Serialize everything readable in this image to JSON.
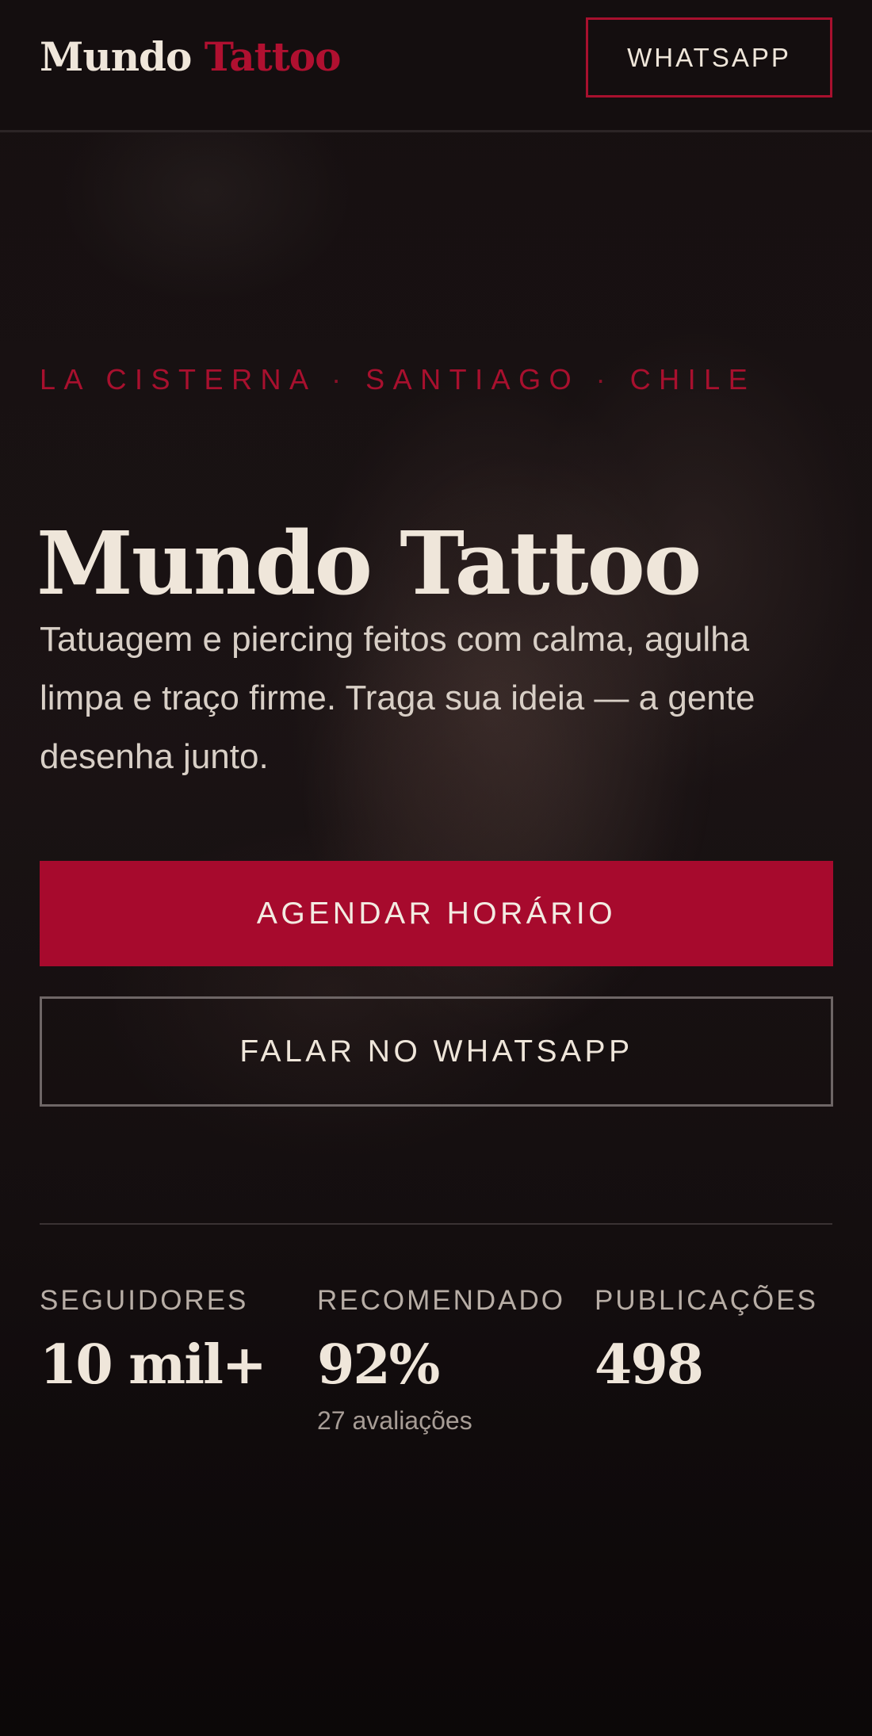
{
  "header": {
    "brand_part1": "Mundo",
    "brand_part2": "Tattoo",
    "whatsapp_label": "WHATSAPP"
  },
  "hero": {
    "location": {
      "part1": "LA CISTERNA",
      "separator": "·",
      "part2": "SANTIAGO",
      "part3": "CHILE"
    },
    "title": "Mundo Tattoo",
    "description": "Tatuagem e piercing feitos com calma, agulha limpa e traço firme. Traga sua ideia — a gente desenha junto.",
    "primary_cta": "AGENDAR HORÁRIO",
    "secondary_cta": "FALAR NO WHATSAPP"
  },
  "stats": [
    {
      "label": "SEGUIDORES",
      "value": "10 mil+",
      "sub": ""
    },
    {
      "label": "RECOMENDADO",
      "value": "92%",
      "sub": "27 avaliações"
    },
    {
      "label": "PUBLICAÇÕES",
      "value": "498",
      "sub": ""
    }
  ],
  "colors": {
    "accent": "#a70a2d",
    "background": "#130d0e",
    "text": "#efe6da"
  }
}
